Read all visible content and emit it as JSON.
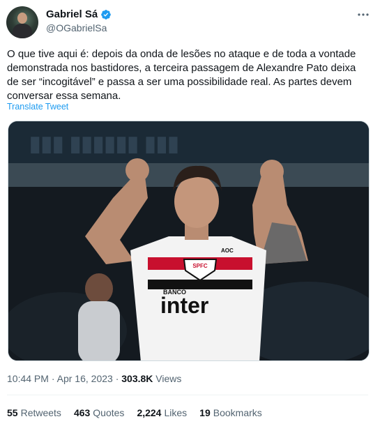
{
  "author": {
    "display_name": "Gabriel Sá",
    "handle": "@OGabrielSa",
    "verified_color": "#1d9bf0"
  },
  "tweet": {
    "text": "O que tive aqui é: depois da onda de lesões no ataque e de toda a vontade demonstrada nos bastidores, a terceira passagem de Alexandre Pato deixa de ser “incogitável” e passa a ser uma possibilidade real. As partes devem conversar essa semana.",
    "translate_label": "Translate Tweet",
    "time": "10:44 PM",
    "separator": "·",
    "date": "Apr 16, 2023",
    "views_count": "303.8K",
    "views_label": "Views"
  },
  "media": {
    "jersey_badge": "SPFC",
    "sponsor_top": "BANCO",
    "sponsor_main": "inter",
    "brand_text": "AOC"
  },
  "stats": [
    {
      "count": "55",
      "label": "Retweets"
    },
    {
      "count": "463",
      "label": "Quotes"
    },
    {
      "count": "2,224",
      "label": "Likes"
    },
    {
      "count": "19",
      "label": "Bookmarks"
    }
  ],
  "icons": {
    "more": "more-options-icon",
    "verified": "verified-badge-icon"
  }
}
